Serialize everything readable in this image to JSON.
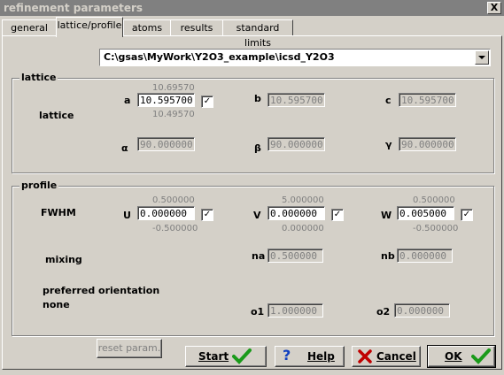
{
  "window": {
    "title": "refinement parameters",
    "close_glyph": "X"
  },
  "tabs": [
    {
      "label": "general"
    },
    {
      "label": "lattice/profile"
    },
    {
      "label": "atoms"
    },
    {
      "label": "results"
    },
    {
      "label": "standard limits"
    }
  ],
  "file_path": "C:\\gsas\\MyWork\\Y2O3_example\\icsd_Y2O3",
  "lattice": {
    "group_label": "lattice",
    "row_label": "lattice",
    "a": {
      "label": "a",
      "value": "10.595700",
      "upper": "10.69570",
      "lower": "10.49570",
      "checked": true
    },
    "b": {
      "label": "b",
      "value": "10.595700"
    },
    "c": {
      "label": "c",
      "value": "10.595700"
    },
    "alpha": {
      "label": "α",
      "value": "90.000000"
    },
    "beta": {
      "label": "β",
      "value": "90.000000"
    },
    "gamma": {
      "label": "γ",
      "value": "90.000000"
    }
  },
  "profile": {
    "group_label": "profile",
    "fwhm_label": "FWHM",
    "U": {
      "label": "U",
      "value": "0.000000",
      "upper": "0.500000",
      "lower": "-0.500000",
      "checked": true
    },
    "V": {
      "label": "V",
      "value": "0.000000",
      "upper": "5.000000",
      "lower": "0.000000",
      "checked": true
    },
    "W": {
      "label": "W",
      "value": "0.005000",
      "upper": "0.500000",
      "lower": "-0.500000",
      "checked": true
    },
    "mixing_label": "mixing",
    "na": {
      "label": "na",
      "value": "0.500000"
    },
    "nb": {
      "label": "nb",
      "value": "0.000000"
    },
    "po_label": "preferred orientation",
    "po_value": "none",
    "o1": {
      "label": "o1",
      "value": "1.000000"
    },
    "o2": {
      "label": "o2",
      "value": "0.000000"
    }
  },
  "buttons": {
    "reset": "reset param.",
    "start": "Start",
    "help": "Help",
    "cancel": "Cancel",
    "ok": "OK"
  },
  "colors": {
    "check_green": "#1a9a1a",
    "cancel_red": "#c00000",
    "help_blue": "#1040c0"
  }
}
